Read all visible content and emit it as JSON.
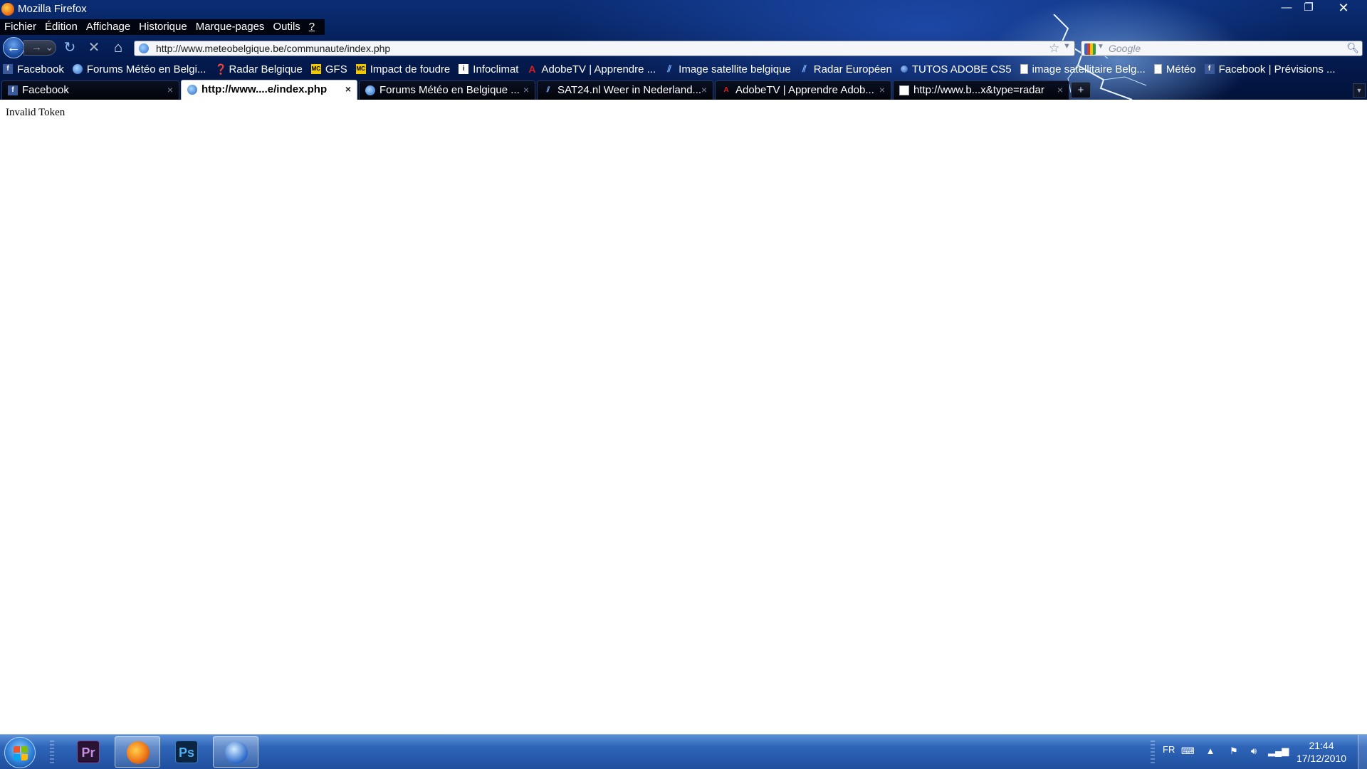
{
  "window": {
    "title": "Mozilla Firefox",
    "min_symbol": "—",
    "max_symbol": "❐",
    "close_symbol": "✕"
  },
  "menu": [
    "Fichier",
    "Édition",
    "Affichage",
    "Historique",
    "Marque-pages",
    "Outils",
    "?"
  ],
  "navbar": {
    "back_symbol": "←",
    "forward_symbol": "→ ⌄",
    "reload_symbol": "↻",
    "stop_symbol": "✕",
    "home_symbol": "⌂",
    "url": "http://www.meteobelgique.be/communaute/index.php",
    "search_placeholder": "Google"
  },
  "bookmarks": [
    {
      "label": "Facebook",
      "icon": "facebook-icon"
    },
    {
      "label": "Forums Météo en Belgi...",
      "icon": "globe-icon"
    },
    {
      "label": "Radar Belgique",
      "icon": "question-icon"
    },
    {
      "label": "GFS",
      "icon": "meteociel-icon"
    },
    {
      "label": "Impact de foudre",
      "icon": "meteociel-icon"
    },
    {
      "label": "Infoclimat",
      "icon": "infoclimat-icon"
    },
    {
      "label": "AdobeTV | Apprendre ...",
      "icon": "adobe-icon"
    },
    {
      "label": "Image satellite belgique",
      "icon": "satellite-icon"
    },
    {
      "label": "Radar Européen",
      "icon": "satellite-icon"
    },
    {
      "label": "TUTOS ADOBE CS5",
      "icon": "globe-icon"
    },
    {
      "label": "image satellitaire Belg...",
      "icon": "page-icon"
    },
    {
      "label": "Météo",
      "icon": "page-icon"
    },
    {
      "label": "Facebook | Prévisions ...",
      "icon": "facebook-icon"
    }
  ],
  "tabs": [
    {
      "label": "Facebook",
      "icon": "facebook-icon",
      "active": false
    },
    {
      "label": "http://www....e/index.php",
      "icon": "globe-icon",
      "active": true
    },
    {
      "label": "Forums Météo en Belgique ...",
      "icon": "globe-icon",
      "active": false
    },
    {
      "label": "SAT24.nl Weer in Nederland...",
      "icon": "satellite-icon",
      "active": false
    },
    {
      "label": "AdobeTV | Apprendre Adob...",
      "icon": "adobe-icon",
      "active": false
    },
    {
      "label": "http://www.b...x&type=radar",
      "icon": "page-icon",
      "active": false
    }
  ],
  "tab_close_symbol": "×",
  "new_tab_symbol": "+",
  "page": {
    "text": "Invalid Token"
  },
  "taskbar": {
    "apps": [
      {
        "name": "Adobe Premiere",
        "label": "Pr",
        "running": false
      },
      {
        "name": "Firefox",
        "label": "",
        "running": true
      },
      {
        "name": "Photoshop",
        "label": "Ps",
        "running": false
      },
      {
        "name": "Google Earth",
        "label": "",
        "running": true
      }
    ],
    "language": "FR",
    "time": "21:44",
    "date": "17/12/2010"
  },
  "colors": {
    "chrome_dark": "#041c52",
    "taskbar_blue": "#2f65b8",
    "active_tab": "#ffffff"
  }
}
